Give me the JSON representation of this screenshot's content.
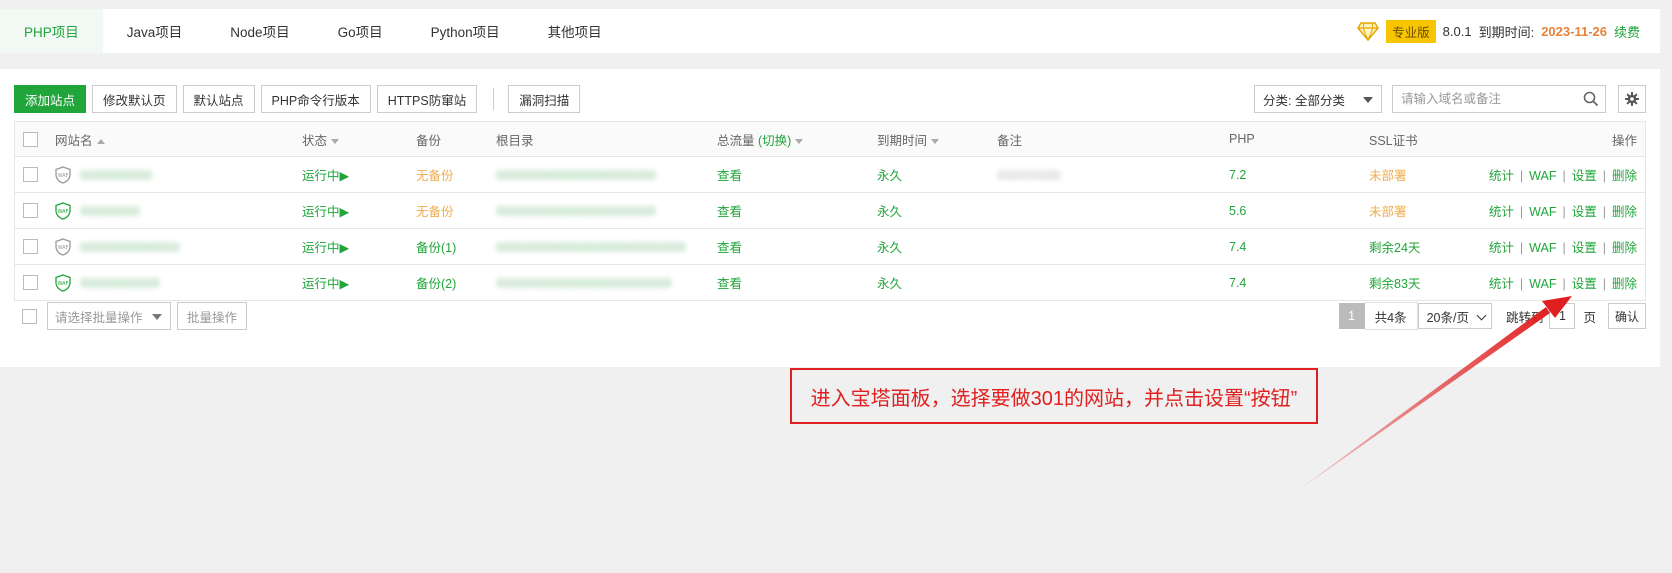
{
  "tabs": [
    {
      "label": "PHP项目",
      "active": true
    },
    {
      "label": "Java项目"
    },
    {
      "label": "Node项目"
    },
    {
      "label": "Go项目"
    },
    {
      "label": "Python项目"
    },
    {
      "label": "其他项目"
    }
  ],
  "header": {
    "edition": "专业版",
    "version": "8.0.1",
    "expire_label": "到期时间:",
    "expire_date": "2023-11-26",
    "renew": "续费"
  },
  "toolbar": {
    "add_site": "添加站点",
    "modify_default_page": "修改默认页",
    "default_site": "默认站点",
    "php_cli_version": "PHP命令行版本",
    "https_anti_spoof": "HTTPS防窜站",
    "vuln_scan": "漏洞扫描",
    "category_select": "分类: 全部分类",
    "search_placeholder": "请输入域名或备注"
  },
  "table": {
    "headers": {
      "site_name": "网站名",
      "status": "状态",
      "backup": "备份",
      "root": "根目录",
      "traffic": "总流量",
      "traffic_switch": "(切换)",
      "expire": "到期时间",
      "remark": "备注",
      "php": "PHP",
      "ssl": "SSL证书",
      "actions": "操作"
    },
    "rows": [
      {
        "status": "运行中▶",
        "backup": "无备份",
        "traffic": "查看",
        "expire": "永久",
        "php": "7.2",
        "ssl": "未部署"
      },
      {
        "status": "运行中▶",
        "backup": "无备份",
        "traffic": "查看",
        "expire": "永久",
        "php": "5.6",
        "ssl": "未部署"
      },
      {
        "status": "运行中▶",
        "backup": "备份(1)",
        "traffic": "查看",
        "expire": "永久",
        "php": "7.4",
        "ssl": "剩余24天"
      },
      {
        "status": "运行中▶",
        "backup": "备份(2)",
        "traffic": "查看",
        "expire": "永久",
        "php": "7.4",
        "ssl": "剩余83天"
      }
    ],
    "ops": {
      "stats": "统计",
      "waf": "WAF",
      "settings": "设置",
      "delete": "删除",
      "separator": "|"
    }
  },
  "footer": {
    "batch_placeholder": "请选择批量操作",
    "batch_button": "批量操作",
    "current_page": "1",
    "total": "共4条",
    "per_page": "20条/页",
    "jump_to": "跳转到",
    "jump_value": "1",
    "page_unit": "页",
    "confirm": "确认"
  },
  "annotation": {
    "text": "进入宝塔面板，选择要做301的网站，并点击设置“按钮”",
    "color": "#e02020"
  },
  "colors": {
    "accent": "#20a53a",
    "warning": "#f0ad4e",
    "badge": "#f7c600"
  }
}
